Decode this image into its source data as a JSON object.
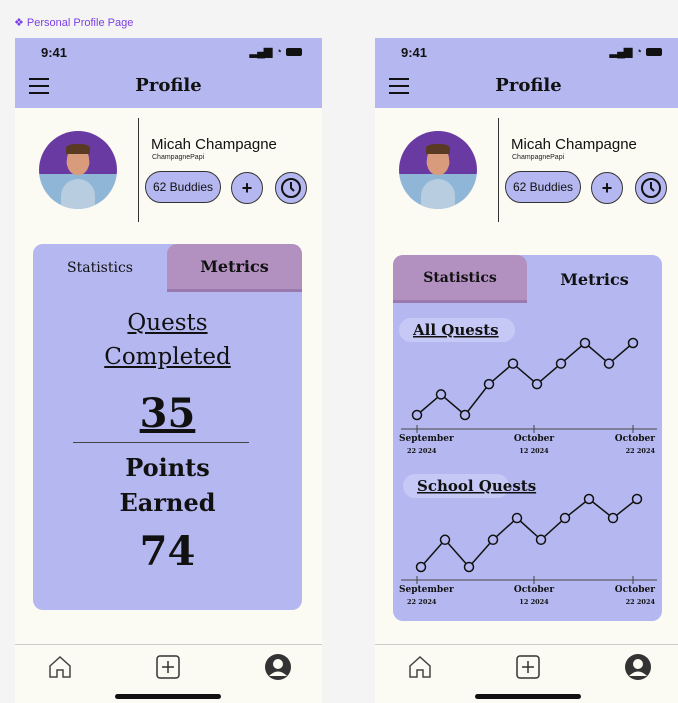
{
  "frame_label": "❖ Personal Profile Page",
  "status": {
    "time": "9:41"
  },
  "header": {
    "title": "Profile"
  },
  "profile": {
    "name": "Micah Champagne",
    "handle": "ChampagnePapi",
    "buddies_label": "62 Buddies",
    "add_label": "+"
  },
  "tabs": {
    "statistics": "Statistics",
    "metrics": "Metrics"
  },
  "stats": {
    "quests_line1": "Quests",
    "quests_line2": "Completed",
    "quests_value": "35",
    "points_line1": "Points",
    "points_line2": "Earned",
    "points_value": "74"
  },
  "chart_data": [
    {
      "type": "line",
      "title": "All Quests",
      "x_ticks": [
        {
          "line1": "September",
          "line2": "22 2024"
        },
        {
          "line1": "October",
          "line2": "12 2024"
        },
        {
          "line1": "October",
          "line2": "22 2024"
        }
      ],
      "y": [
        1,
        2,
        1,
        2.5,
        3.5,
        2.5,
        3.5,
        4.5,
        3.5,
        4.5
      ]
    },
    {
      "type": "line",
      "title": "School Quests",
      "x_ticks": [
        {
          "line1": "September",
          "line2": "22 2024"
        },
        {
          "line1": "October",
          "line2": "12 2024"
        },
        {
          "line1": "October",
          "line2": "22 2024"
        }
      ],
      "y": [
        1,
        2,
        1,
        2,
        2.8,
        2,
        2.8,
        3.5,
        2.8,
        3.5
      ]
    }
  ],
  "nav": {
    "home": "home-icon",
    "add": "plus-square-icon",
    "profile": "user-circle-icon"
  },
  "colors": {
    "lavender": "#b5b8f0",
    "mauve": "#b290c0",
    "bg": "#fbfaf3"
  }
}
